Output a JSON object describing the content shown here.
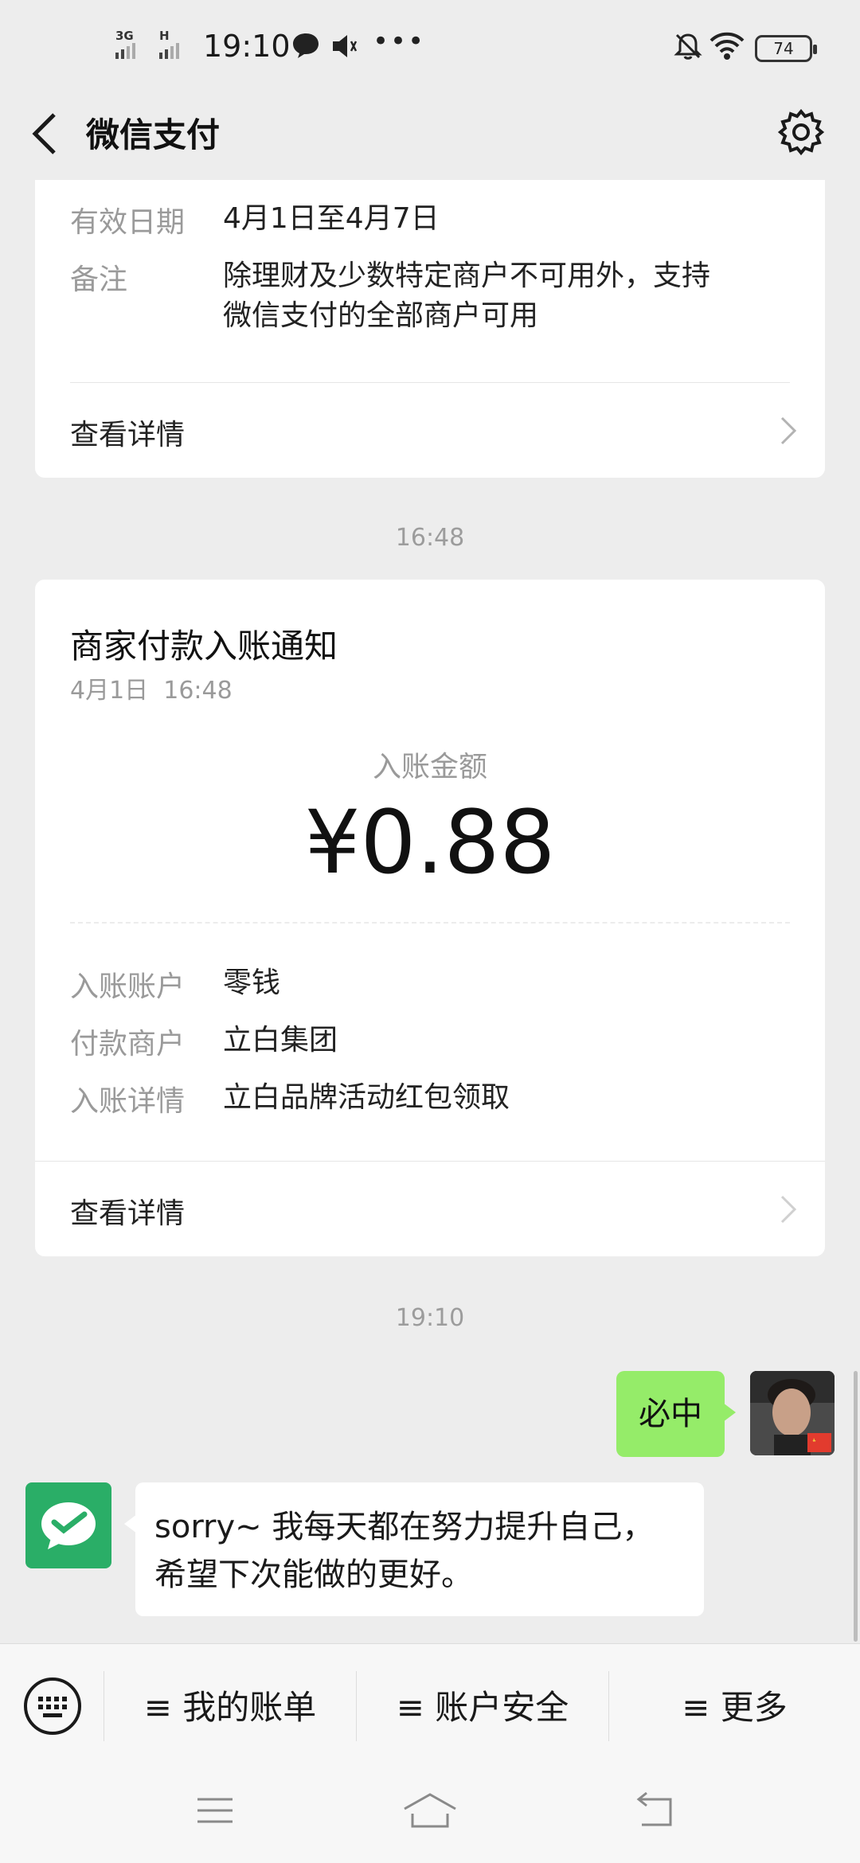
{
  "status_bar": {
    "network1": "3G",
    "network2": "H",
    "time": "19:10",
    "more": "•••",
    "battery": "74"
  },
  "header": {
    "title": "微信支付"
  },
  "coupon_card": {
    "validity_label": "有效日期",
    "validity_value": "4月1日至4月7日",
    "note_label": "备注",
    "note_line1": "除理财及少数特定商户不可用外，支持",
    "note_line2": "微信支付的全部商户可用",
    "detail_link": "查看详情"
  },
  "time_1": "16:48",
  "payment_card": {
    "title": "商家付款入账通知",
    "datetime": "4月1日  16:48",
    "amount_label": "入账金额",
    "amount": "¥0.88",
    "rows": [
      {
        "label": "入账账户",
        "value": "零钱"
      },
      {
        "label": "付款商户",
        "value": "立白集团"
      },
      {
        "label": "入账详情",
        "value": "立白品牌活动红包领取"
      }
    ],
    "detail_link": "查看详情"
  },
  "time_2": "19:10",
  "chat": {
    "my_message": "必中",
    "bot_line1": "sorry~ 我每天都在努力提升自己，",
    "bot_line2": "希望下次能做的更好。"
  },
  "menu": {
    "item1": "≡ 我的账单",
    "item2": "≡ 账户安全",
    "item3": "≡ 更多"
  },
  "colors": {
    "background": "#ededed",
    "my_bubble": "#95ec69",
    "wechat_green": "#2aae67"
  }
}
